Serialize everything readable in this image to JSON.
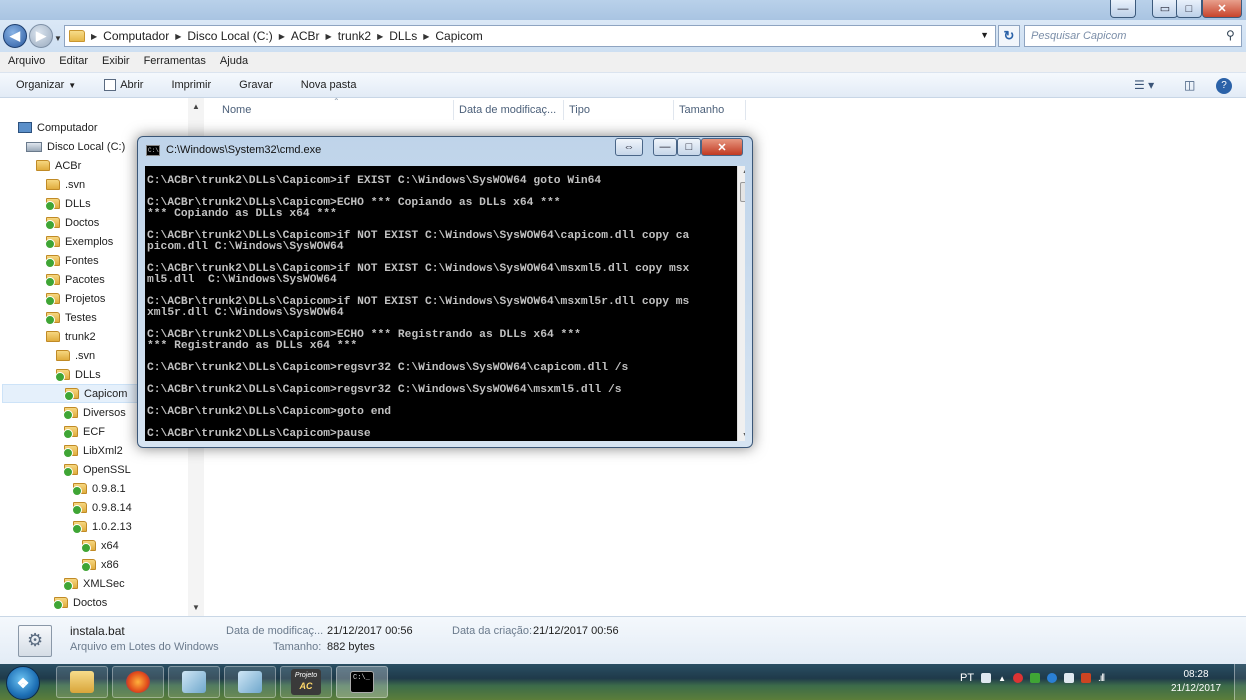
{
  "address": {
    "crumbs": [
      "Computador",
      "Disco Local (C:)",
      "ACBr",
      "trunk2",
      "DLLs",
      "Capicom"
    ],
    "search_placeholder": "Pesquisar Capicom"
  },
  "menu": [
    "Arquivo",
    "Editar",
    "Exibir",
    "Ferramentas",
    "Ajuda"
  ],
  "commands": {
    "organize": "Organizar",
    "open": "Abrir",
    "print": "Imprimir",
    "burn": "Gravar",
    "new_folder": "Nova pasta"
  },
  "columns": {
    "name": "Nome",
    "modified": "Data de modificaç...",
    "type": "Tipo",
    "size": "Tamanho"
  },
  "tree": [
    {
      "label": "Computador"
    },
    {
      "label": "Disco Local (C:)"
    },
    {
      "label": "ACBr"
    },
    {
      "label": ".svn"
    },
    {
      "label": "DLLs"
    },
    {
      "label": "Doctos"
    },
    {
      "label": "Exemplos"
    },
    {
      "label": "Fontes"
    },
    {
      "label": "Pacotes"
    },
    {
      "label": "Projetos"
    },
    {
      "label": "Testes"
    },
    {
      "label": "trunk2"
    },
    {
      "label": ".svn"
    },
    {
      "label": "DLLs"
    },
    {
      "label": "Capicom"
    },
    {
      "label": "Diversos"
    },
    {
      "label": "ECF"
    },
    {
      "label": "LibXml2"
    },
    {
      "label": "OpenSSL"
    },
    {
      "label": "0.9.8.1"
    },
    {
      "label": "0.9.8.14"
    },
    {
      "label": "1.0.2.13"
    },
    {
      "label": "x64"
    },
    {
      "label": "x86"
    },
    {
      "label": "XMLSec"
    },
    {
      "label": "Doctos"
    }
  ],
  "cmd": {
    "title": "C:\\Windows\\System32\\cmd.exe",
    "lines": [
      "C:\\ACBr\\trunk2\\DLLs\\Capicom>if EXIST C:\\Windows\\SysWOW64 goto Win64",
      "",
      "C:\\ACBr\\trunk2\\DLLs\\Capicom>ECHO *** Copiando as DLLs x64 ***",
      "*** Copiando as DLLs x64 ***",
      "",
      "C:\\ACBr\\trunk2\\DLLs\\Capicom>if NOT EXIST C:\\Windows\\SysWOW64\\capicom.dll copy ca",
      "picom.dll C:\\Windows\\SysWOW64",
      "",
      "C:\\ACBr\\trunk2\\DLLs\\Capicom>if NOT EXIST C:\\Windows\\SysWOW64\\msxml5.dll copy msx",
      "ml5.dll  C:\\Windows\\SysWOW64",
      "",
      "C:\\ACBr\\trunk2\\DLLs\\Capicom>if NOT EXIST C:\\Windows\\SysWOW64\\msxml5r.dll copy ms",
      "xml5r.dll C:\\Windows\\SysWOW64",
      "",
      "C:\\ACBr\\trunk2\\DLLs\\Capicom>ECHO *** Registrando as DLLs x64 ***",
      "*** Registrando as DLLs x64 ***",
      "",
      "C:\\ACBr\\trunk2\\DLLs\\Capicom>regsvr32 C:\\Windows\\SysWOW64\\capicom.dll /s",
      "",
      "C:\\ACBr\\trunk2\\DLLs\\Capicom>regsvr32 C:\\Windows\\SysWOW64\\msxml5.dll /s",
      "",
      "C:\\ACBr\\trunk2\\DLLs\\Capicom>goto end",
      "",
      "C:\\ACBr\\trunk2\\DLLs\\Capicom>pause"
    ]
  },
  "details": {
    "filename": "instala.bat",
    "filetype": "Arquivo em Lotes do Windows",
    "modified_label": "Data de modificaç...",
    "modified_value": "21/12/2017 00:56",
    "size_label": "Tamanho:",
    "size_value": "882 bytes",
    "created_label": "Data da criação:",
    "created_value": "21/12/2017 00:56"
  },
  "taskbar": {
    "projeto_label": "Projeto",
    "lang": "PT",
    "time": "08:28",
    "date": "21/12/2017"
  },
  "colors": {
    "console_bg": "#000000",
    "console_fg": "#c0c0c0",
    "selection": "#e5f0fb"
  }
}
